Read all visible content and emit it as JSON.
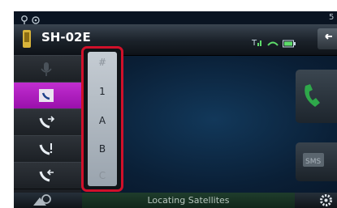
{
  "header": {
    "device_name": "SH-02E"
  },
  "index_strip": {
    "items": [
      "#",
      "1",
      "A",
      "B",
      "C"
    ]
  },
  "footer": {
    "status_text": "Locating Satellites"
  },
  "status_bar": {
    "right_text": "5"
  },
  "colors": {
    "accent": "#b01cc0",
    "highlight_border": "#d0102a",
    "call_green": "#2ea84a"
  },
  "icons": {
    "status": [
      "location-icon",
      "bluetooth-icon"
    ],
    "header": [
      "phone-icon",
      "signal-icon",
      "handset-icon",
      "battery-icon",
      "back-icon"
    ],
    "sidebar": [
      "voice-dial-icon",
      "phonebook-icon",
      "outgoing-calls-icon",
      "missed-calls-icon",
      "incoming-calls-icon"
    ],
    "right": [
      "call-icon",
      "sms-icon"
    ],
    "bottom": [
      "navigation-icon",
      "settings-icon"
    ]
  }
}
